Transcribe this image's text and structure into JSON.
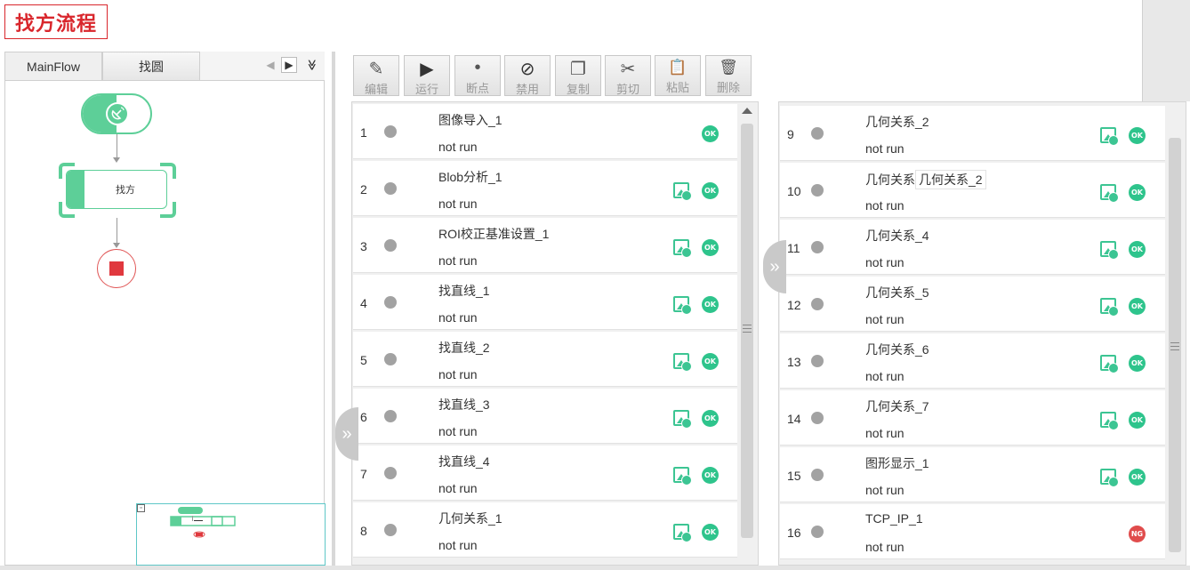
{
  "header": {
    "title": "找方流程"
  },
  "tabs": {
    "items": [
      {
        "label": "MainFlow"
      },
      {
        "label": "找圆"
      }
    ],
    "prev_glyph": "◀",
    "next_glyph": "▶",
    "more_glyph": "≫"
  },
  "canvas": {
    "start_icon": "satellite-dish-icon",
    "process_node": {
      "label": "找方"
    },
    "end_icon": "stop-icon",
    "minimap_toggle": "▫"
  },
  "toolbar": {
    "buttons": [
      {
        "label": "编辑",
        "icon": "edit-icon",
        "glyph": "✎"
      },
      {
        "label": "运行",
        "icon": "play-icon",
        "glyph": "▶"
      },
      {
        "label": "断点",
        "icon": "breakpoint-icon",
        "glyph": "•"
      },
      {
        "label": "禁用",
        "icon": "disable-icon",
        "glyph": "⊘"
      },
      {
        "label": "复制",
        "icon": "copy-icon",
        "glyph": "❐"
      },
      {
        "label": "剪切",
        "icon": "scissors-icon",
        "glyph": "✂"
      },
      {
        "label": "粘贴",
        "icon": "paste-icon",
        "glyph": "📋"
      },
      {
        "label": "删除",
        "icon": "trash-icon",
        "glyph": "🗑"
      }
    ]
  },
  "modules_left": [
    {
      "index": "1",
      "name": "图像导入_1",
      "status": "not run",
      "has_image": false,
      "result": "OK"
    },
    {
      "index": "2",
      "name": "Blob分析_1",
      "status": "not run",
      "has_image": true,
      "result": "OK"
    },
    {
      "index": "3",
      "name": "ROI校正基准设置_1",
      "status": "not run",
      "has_image": true,
      "result": "OK"
    },
    {
      "index": "4",
      "name": "找直线_1",
      "status": "not run",
      "has_image": true,
      "result": "OK"
    },
    {
      "index": "5",
      "name": "找直线_2",
      "status": "not run",
      "has_image": true,
      "result": "OK"
    },
    {
      "index": "6",
      "name": "找直线_3",
      "status": "not run",
      "has_image": true,
      "result": "OK"
    },
    {
      "index": "7",
      "name": "找直线_4",
      "status": "not run",
      "has_image": true,
      "result": "OK"
    },
    {
      "index": "8",
      "name": "几何关系_1",
      "status": "not run",
      "has_image": true,
      "result": "OK"
    }
  ],
  "modules_right": [
    {
      "index": "9",
      "name": "几何关系_2",
      "status": "not run",
      "has_image": true,
      "result": "OK"
    },
    {
      "index": "10",
      "name": "几何关系",
      "chip": "几何关系_2",
      "status": "not run",
      "has_image": true,
      "result": "OK"
    },
    {
      "index": "11",
      "name": "几何关系_4",
      "status": "not run",
      "has_image": true,
      "result": "OK"
    },
    {
      "index": "12",
      "name": "几何关系_5",
      "status": "not run",
      "has_image": true,
      "result": "OK"
    },
    {
      "index": "13",
      "name": "几何关系_6",
      "status": "not run",
      "has_image": true,
      "result": "OK"
    },
    {
      "index": "14",
      "name": "几何关系_7",
      "status": "not run",
      "has_image": true,
      "result": "OK"
    },
    {
      "index": "15",
      "name": "图形显示_1",
      "status": "not run",
      "has_image": true,
      "result": "OK"
    },
    {
      "index": "16",
      "name": "TCP_IP_1",
      "status": "not run",
      "has_image": false,
      "result": "NG"
    }
  ],
  "collapse_glyph": "»",
  "colors": {
    "title_red": "#d9262c",
    "ok_green": "#2ec48c",
    "ng_red": "#e04c4c",
    "node_green": "#5dcf98"
  }
}
